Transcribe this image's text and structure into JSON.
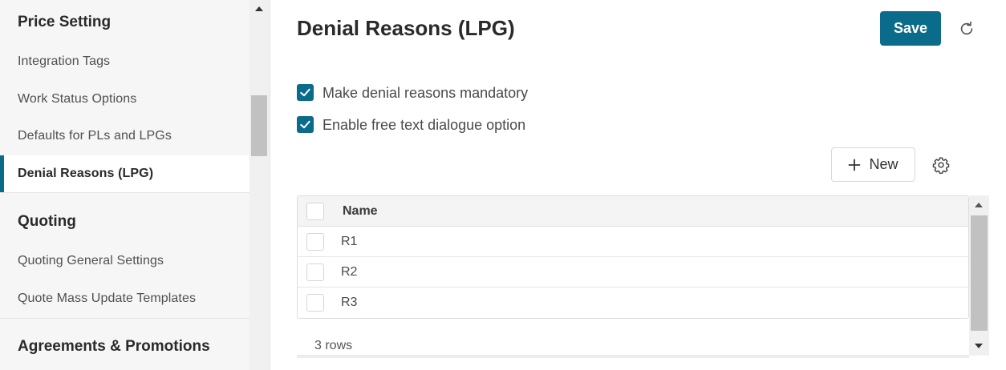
{
  "sidebar": {
    "sections": [
      {
        "title": "Price Setting"
      },
      {
        "title": "Quoting"
      },
      {
        "title": "Agreements & Promotions"
      }
    ],
    "items": [
      {
        "label": "Integration Tags"
      },
      {
        "label": "Work Status Options"
      },
      {
        "label": "Defaults for PLs and LPGs"
      },
      {
        "label": "Denial Reasons (LPG)"
      },
      {
        "label": "Quoting General Settings"
      },
      {
        "label": "Quote Mass Update Templates"
      }
    ],
    "active_item": "Denial Reasons (LPG)"
  },
  "header": {
    "title": "Denial Reasons (LPG)",
    "save_label": "Save",
    "refresh_icon": "refresh-icon"
  },
  "options": {
    "mandatory": {
      "label": "Make denial reasons mandatory",
      "checked": true
    },
    "free_text": {
      "label": "Enable free text dialogue option",
      "checked": true
    }
  },
  "toolbar": {
    "new_label": "New",
    "new_icon": "plus-icon",
    "settings_icon": "gear-icon"
  },
  "table": {
    "columns": [
      "Name"
    ],
    "rows": [
      {
        "name": "R1"
      },
      {
        "name": "R2"
      },
      {
        "name": "R3"
      }
    ],
    "footer": "3 rows"
  },
  "colors": {
    "accent": "#0a6b8a",
    "sidebar_bg": "#f6f6f6"
  }
}
